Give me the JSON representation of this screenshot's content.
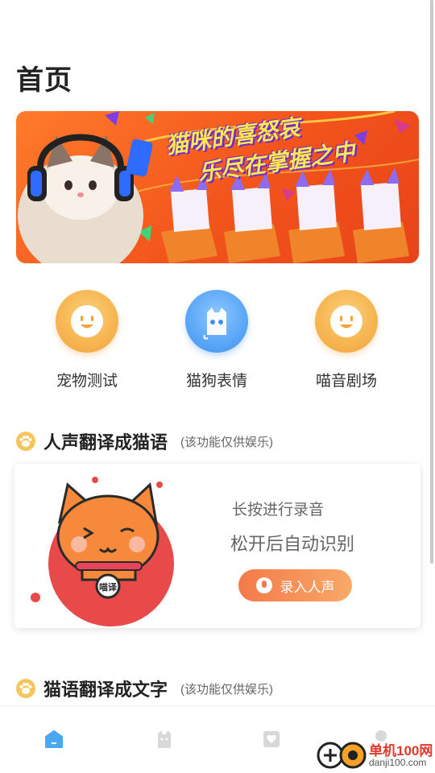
{
  "header": {
    "title": "首页"
  },
  "banner": {
    "line1": "猫咪的喜怒哀",
    "line2": "乐尽在掌握之中"
  },
  "quick_actions": [
    {
      "label": "宠物测试",
      "icon": "smile-face-icon",
      "color": "#f6b450"
    },
    {
      "label": "猫狗表情",
      "icon": "cat-face-icon",
      "color": "#5aa6f7"
    },
    {
      "label": "喵音剧场",
      "icon": "smile-face-icon",
      "color": "#f6b450"
    }
  ],
  "section_voice": {
    "title": "人声翻译成猫语",
    "note": "(该功能仅供娱乐)"
  },
  "voice_card": {
    "hint1": "长按进行录音",
    "hint2": "松开后自动识别",
    "badge": "喵译",
    "record_button": "录入人声",
    "accent": "#f47a4a"
  },
  "section_text": {
    "title": "猫语翻译成文字",
    "note": "(该功能仅供娱乐)"
  },
  "tabbar": {
    "items": [
      {
        "icon": "home-icon",
        "active": true
      },
      {
        "icon": "cat-icon",
        "active": false
      },
      {
        "icon": "heart-card-icon",
        "active": false
      },
      {
        "icon": "profile-icon",
        "active": false
      }
    ],
    "active_color": "#4aa8f0"
  },
  "watermark": {
    "name": "单机100网",
    "url": "danji100.com"
  }
}
